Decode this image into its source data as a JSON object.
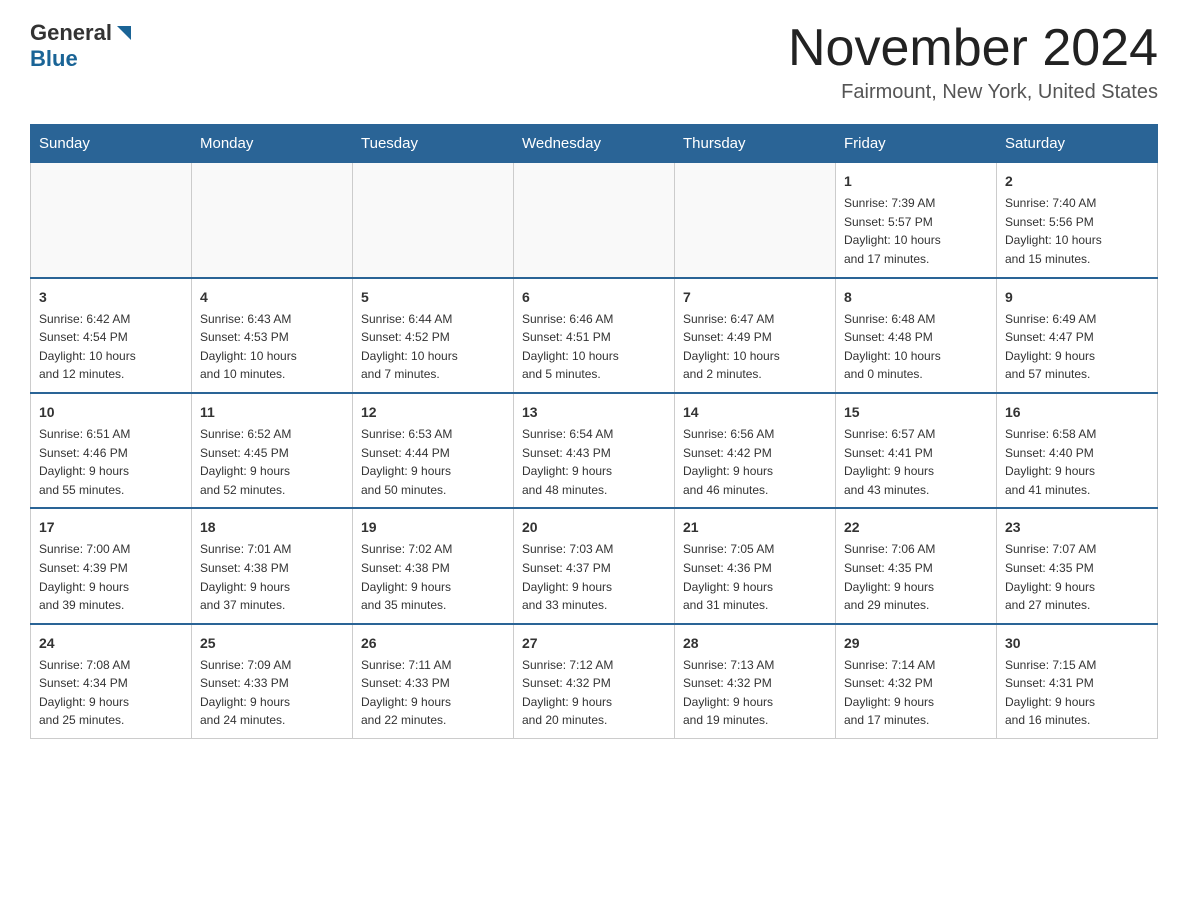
{
  "header": {
    "logo_general": "General",
    "logo_blue": "Blue",
    "month_title": "November 2024",
    "location": "Fairmount, New York, United States"
  },
  "days_of_week": [
    "Sunday",
    "Monday",
    "Tuesday",
    "Wednesday",
    "Thursday",
    "Friday",
    "Saturday"
  ],
  "weeks": [
    [
      {
        "day": "",
        "info": ""
      },
      {
        "day": "",
        "info": ""
      },
      {
        "day": "",
        "info": ""
      },
      {
        "day": "",
        "info": ""
      },
      {
        "day": "",
        "info": ""
      },
      {
        "day": "1",
        "info": "Sunrise: 7:39 AM\nSunset: 5:57 PM\nDaylight: 10 hours\nand 17 minutes."
      },
      {
        "day": "2",
        "info": "Sunrise: 7:40 AM\nSunset: 5:56 PM\nDaylight: 10 hours\nand 15 minutes."
      }
    ],
    [
      {
        "day": "3",
        "info": "Sunrise: 6:42 AM\nSunset: 4:54 PM\nDaylight: 10 hours\nand 12 minutes."
      },
      {
        "day": "4",
        "info": "Sunrise: 6:43 AM\nSunset: 4:53 PM\nDaylight: 10 hours\nand 10 minutes."
      },
      {
        "day": "5",
        "info": "Sunrise: 6:44 AM\nSunset: 4:52 PM\nDaylight: 10 hours\nand 7 minutes."
      },
      {
        "day": "6",
        "info": "Sunrise: 6:46 AM\nSunset: 4:51 PM\nDaylight: 10 hours\nand 5 minutes."
      },
      {
        "day": "7",
        "info": "Sunrise: 6:47 AM\nSunset: 4:49 PM\nDaylight: 10 hours\nand 2 minutes."
      },
      {
        "day": "8",
        "info": "Sunrise: 6:48 AM\nSunset: 4:48 PM\nDaylight: 10 hours\nand 0 minutes."
      },
      {
        "day": "9",
        "info": "Sunrise: 6:49 AM\nSunset: 4:47 PM\nDaylight: 9 hours\nand 57 minutes."
      }
    ],
    [
      {
        "day": "10",
        "info": "Sunrise: 6:51 AM\nSunset: 4:46 PM\nDaylight: 9 hours\nand 55 minutes."
      },
      {
        "day": "11",
        "info": "Sunrise: 6:52 AM\nSunset: 4:45 PM\nDaylight: 9 hours\nand 52 minutes."
      },
      {
        "day": "12",
        "info": "Sunrise: 6:53 AM\nSunset: 4:44 PM\nDaylight: 9 hours\nand 50 minutes."
      },
      {
        "day": "13",
        "info": "Sunrise: 6:54 AM\nSunset: 4:43 PM\nDaylight: 9 hours\nand 48 minutes."
      },
      {
        "day": "14",
        "info": "Sunrise: 6:56 AM\nSunset: 4:42 PM\nDaylight: 9 hours\nand 46 minutes."
      },
      {
        "day": "15",
        "info": "Sunrise: 6:57 AM\nSunset: 4:41 PM\nDaylight: 9 hours\nand 43 minutes."
      },
      {
        "day": "16",
        "info": "Sunrise: 6:58 AM\nSunset: 4:40 PM\nDaylight: 9 hours\nand 41 minutes."
      }
    ],
    [
      {
        "day": "17",
        "info": "Sunrise: 7:00 AM\nSunset: 4:39 PM\nDaylight: 9 hours\nand 39 minutes."
      },
      {
        "day": "18",
        "info": "Sunrise: 7:01 AM\nSunset: 4:38 PM\nDaylight: 9 hours\nand 37 minutes."
      },
      {
        "day": "19",
        "info": "Sunrise: 7:02 AM\nSunset: 4:38 PM\nDaylight: 9 hours\nand 35 minutes."
      },
      {
        "day": "20",
        "info": "Sunrise: 7:03 AM\nSunset: 4:37 PM\nDaylight: 9 hours\nand 33 minutes."
      },
      {
        "day": "21",
        "info": "Sunrise: 7:05 AM\nSunset: 4:36 PM\nDaylight: 9 hours\nand 31 minutes."
      },
      {
        "day": "22",
        "info": "Sunrise: 7:06 AM\nSunset: 4:35 PM\nDaylight: 9 hours\nand 29 minutes."
      },
      {
        "day": "23",
        "info": "Sunrise: 7:07 AM\nSunset: 4:35 PM\nDaylight: 9 hours\nand 27 minutes."
      }
    ],
    [
      {
        "day": "24",
        "info": "Sunrise: 7:08 AM\nSunset: 4:34 PM\nDaylight: 9 hours\nand 25 minutes."
      },
      {
        "day": "25",
        "info": "Sunrise: 7:09 AM\nSunset: 4:33 PM\nDaylight: 9 hours\nand 24 minutes."
      },
      {
        "day": "26",
        "info": "Sunrise: 7:11 AM\nSunset: 4:33 PM\nDaylight: 9 hours\nand 22 minutes."
      },
      {
        "day": "27",
        "info": "Sunrise: 7:12 AM\nSunset: 4:32 PM\nDaylight: 9 hours\nand 20 minutes."
      },
      {
        "day": "28",
        "info": "Sunrise: 7:13 AM\nSunset: 4:32 PM\nDaylight: 9 hours\nand 19 minutes."
      },
      {
        "day": "29",
        "info": "Sunrise: 7:14 AM\nSunset: 4:32 PM\nDaylight: 9 hours\nand 17 minutes."
      },
      {
        "day": "30",
        "info": "Sunrise: 7:15 AM\nSunset: 4:31 PM\nDaylight: 9 hours\nand 16 minutes."
      }
    ]
  ]
}
